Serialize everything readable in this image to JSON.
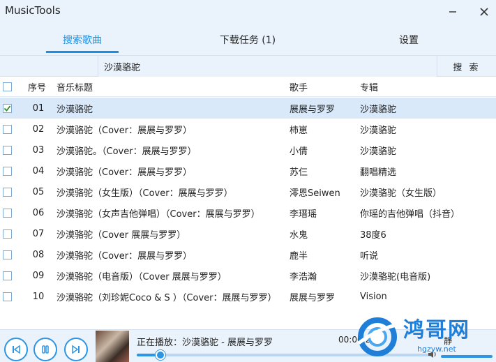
{
  "app": {
    "title": "MusicTools"
  },
  "tabs": [
    {
      "label": "搜索歌曲",
      "active": true
    },
    {
      "label": "下载任务 (1)",
      "active": false
    },
    {
      "label": "设置",
      "active": false
    }
  ],
  "search": {
    "value": "沙漠骆驼",
    "button_label": "搜 索"
  },
  "table": {
    "headers": {
      "num": "序号",
      "title": "音乐标题",
      "singer": "歌手",
      "album": "专辑"
    },
    "rows": [
      {
        "num": "01",
        "title": "沙漠骆驼",
        "singer": "展展与罗罗",
        "album": "沙漠骆驼",
        "checked": true
      },
      {
        "num": "02",
        "title": "沙漠骆驼（Cover：展展与罗罗）",
        "singer": "柿崽",
        "album": "沙漠骆驼",
        "checked": false
      },
      {
        "num": "03",
        "title": "沙漠骆驼。（Cover：展展与罗罗）",
        "singer": "小倩",
        "album": "沙漠骆驼",
        "checked": false
      },
      {
        "num": "04",
        "title": "沙漠骆驼（Cover：展展与罗罗）",
        "singer": "苏仨",
        "album": "翻唱精选",
        "checked": false
      },
      {
        "num": "05",
        "title": "沙漠骆驼（女生版）（Cover：展展与罗罗）",
        "singer": "澪恩Seiwen",
        "album": "沙漠骆驼（女生版）",
        "checked": false
      },
      {
        "num": "06",
        "title": "沙漠骆驼（女声吉他弹唱）（Cover：展展与罗罗）",
        "singer": "李瑨瑶",
        "album": "你瑶的吉他弹唱（抖音）",
        "checked": false
      },
      {
        "num": "07",
        "title": "沙漠骆驼（Cover 展展与罗罗）",
        "singer": "水鬼",
        "album": "38度6",
        "checked": false
      },
      {
        "num": "08",
        "title": "沙漠骆驼（Cover：展展与罗罗）",
        "singer": "鹿半",
        "album": "听说",
        "checked": false
      },
      {
        "num": "09",
        "title": "沙漠骆驼（电音版）（Cover 展展与罗罗）",
        "singer": "李浩瀚",
        "album": "沙漠骆驼(电音版)",
        "checked": false
      },
      {
        "num": "10",
        "title": "沙漠骆驼（刘珍妮Coco & S ）（Cover：展展与罗罗）",
        "singer": "展展与罗罗",
        "album": "Vision",
        "checked": false
      }
    ]
  },
  "player": {
    "now_playing": "正在播放：沙漠骆驼 - 展展与罗罗",
    "time": "00:00:2",
    "mute_label": "静",
    "progress": 0.08,
    "volume": 1.0
  },
  "watermark": {
    "text": "鸿哥网",
    "url": "hgzyw.net"
  },
  "colors": {
    "accent": "#1a8fe3",
    "selected_row": "#d9e9fa",
    "toolbar_bg": "#eaf2fb"
  }
}
